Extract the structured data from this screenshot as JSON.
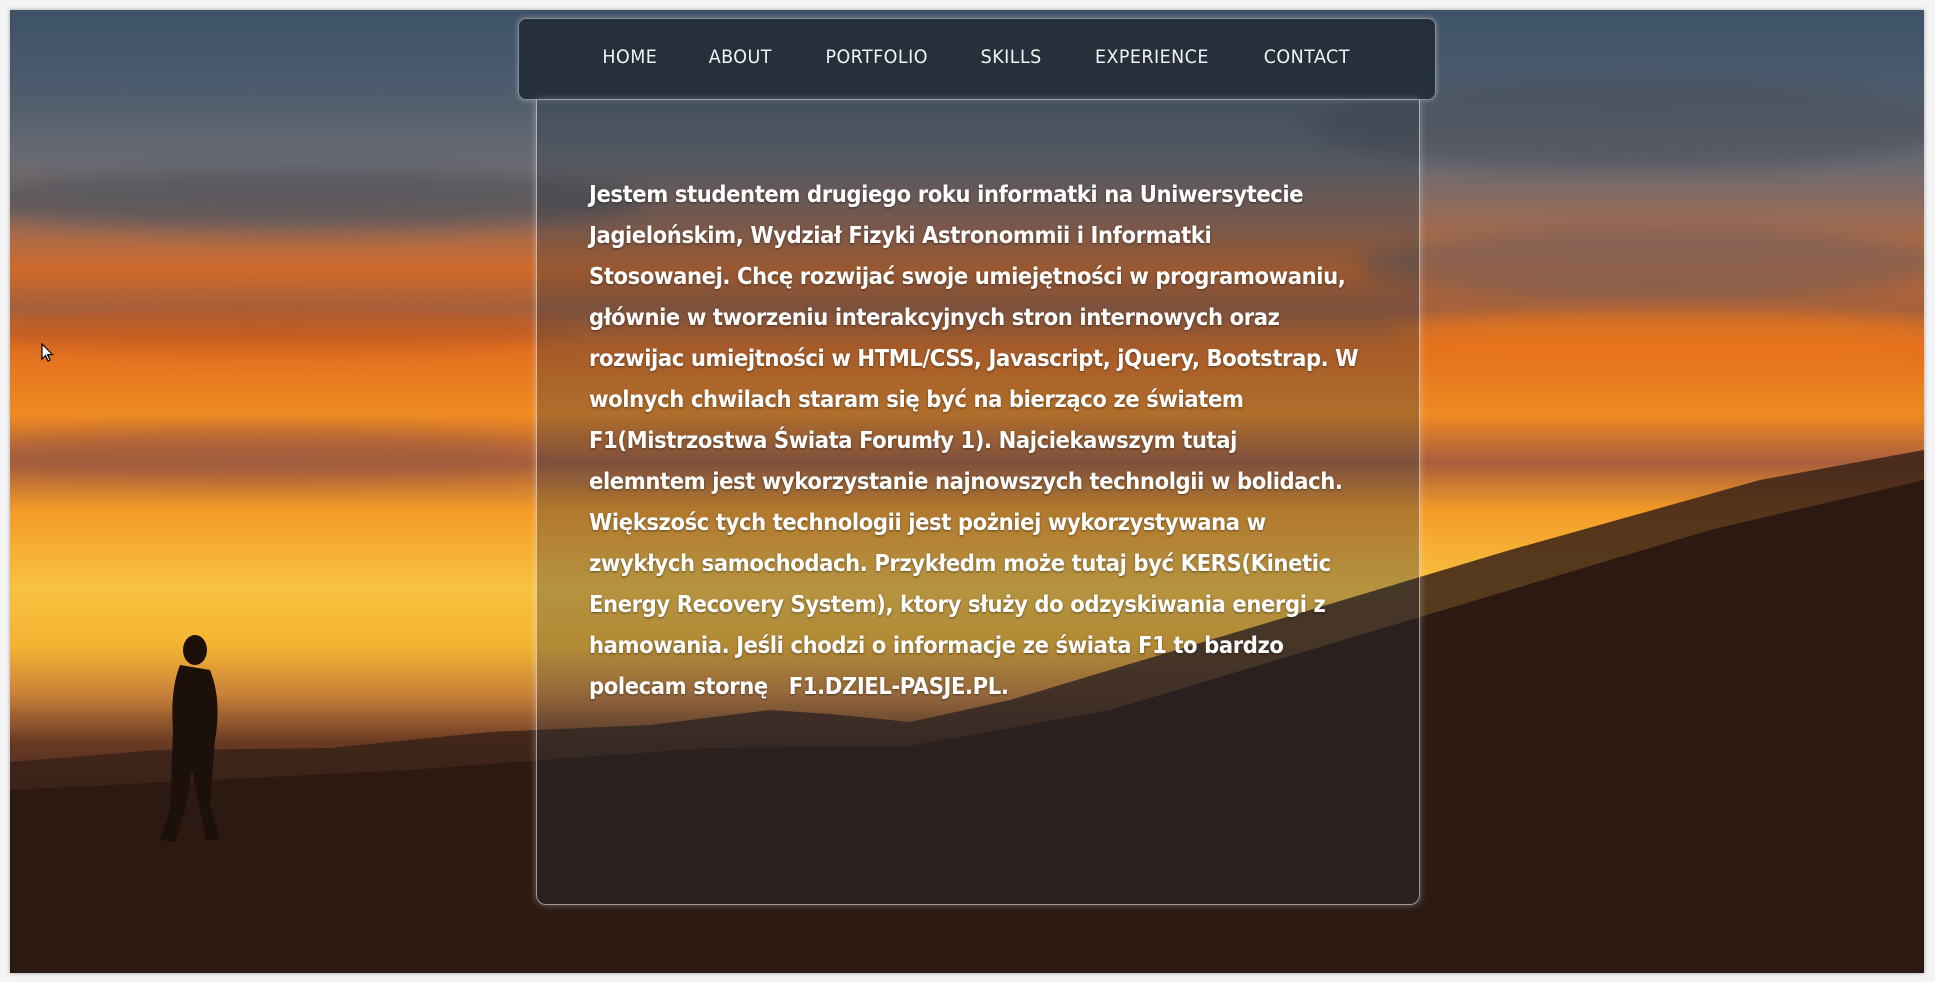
{
  "nav": {
    "items": [
      {
        "label": "HOME"
      },
      {
        "label": "ABOUT"
      },
      {
        "label": "PORTFOLIO"
      },
      {
        "label": "SKILLS"
      },
      {
        "label": "EXPERIENCE"
      },
      {
        "label": "CONTACT"
      }
    ]
  },
  "about": {
    "text": "Jestem studentem drugiego roku informatki na Uniwersytecie Jagielońskim, Wydział Fizyki Astronommii i Informatki Stosowanej. Chcę rozwijać swoje umiejętności w programowaniu, głównie w tworzeniu interakcyjnych stron internowych oraz rozwijac umiejtności w HTML/CSS, Javascript, jQuery, Bootstrap. W wolnych chwilach staram się być na bierząco ze światem F1(Mistrzostwa Świata Forumły 1). Najciekawszym tutaj elemntem jest wykorzystanie najnowszych technolgii w bolidach. Większośc tych technologii jest pożniej wykorzystywana w zwykłych samochodach. Przykłedm może tutaj być KERS(Kinetic Energy Recovery System), ktory służy do odzyskiwania energi z hamowania. Jeśli chodzi o informacje ze świata F1 to bardzo polecam stornę",
    "link_text": "F1.DZIEL-PASJE.PL",
    "end_punct": "."
  },
  "theme": {
    "navbar_bg": "#232d38",
    "text_color": "#ffffff",
    "sky_top": "#3d5268",
    "sunset_orange": "#f08a22",
    "dune_dark": "#241410"
  }
}
